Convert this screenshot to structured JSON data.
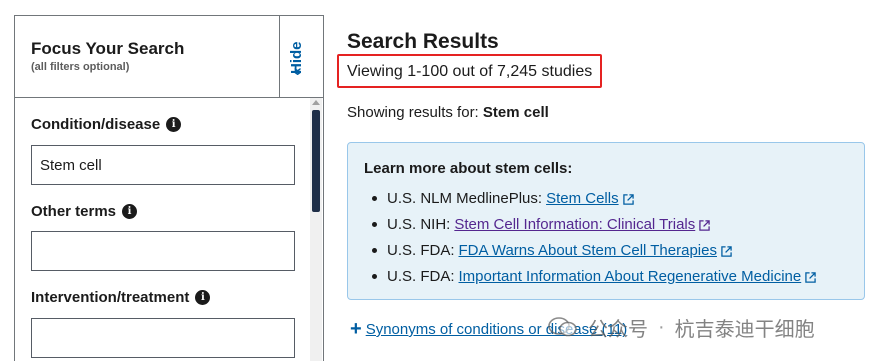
{
  "filter_panel": {
    "title": "Focus Your Search",
    "subtitle": "(all filters optional)",
    "hide_label": "Hide",
    "hide_chevron": "«",
    "fields": [
      {
        "label": "Condition/disease",
        "value": "Stem cell",
        "info_icon": "info-icon"
      },
      {
        "label": "Other terms",
        "value": "",
        "info_icon": "info-icon"
      },
      {
        "label": "Intervention/treatment",
        "value": "",
        "info_icon": "info-icon"
      }
    ]
  },
  "results": {
    "title": "Search Results",
    "viewing_text": "Viewing 1-100 out of 7,245 studies",
    "showing_prefix": "Showing results for: ",
    "showing_term": "Stem cell"
  },
  "learn_more": {
    "heading": "Learn more about stem cells:",
    "items": [
      {
        "source": "U.S. NLM MedlinePlus:",
        "link": "Stem Cells",
        "visited": false
      },
      {
        "source": "U.S. NIH:",
        "link": "Stem Cell Information: Clinical Trials",
        "visited": true
      },
      {
        "source": "U.S. FDA:",
        "link": "FDA Warns About Stem Cell Therapies",
        "visited": false
      },
      {
        "source": "U.S. FDA:",
        "link": "Important Information About Regenerative Medicine",
        "visited": false
      }
    ]
  },
  "synonyms": {
    "icon": "+",
    "label": "Synonyms of conditions or disease (11)"
  },
  "watermark": {
    "account": "公众号",
    "separator": "·",
    "name": "杭吉泰迪干细胞"
  },
  "colors": {
    "link": "#005ea2",
    "visited_link": "#54278f",
    "highlight_border": "#e52221",
    "info_box_bg": "#e7f2f8",
    "scroll_thumb": "#1f2f48"
  }
}
